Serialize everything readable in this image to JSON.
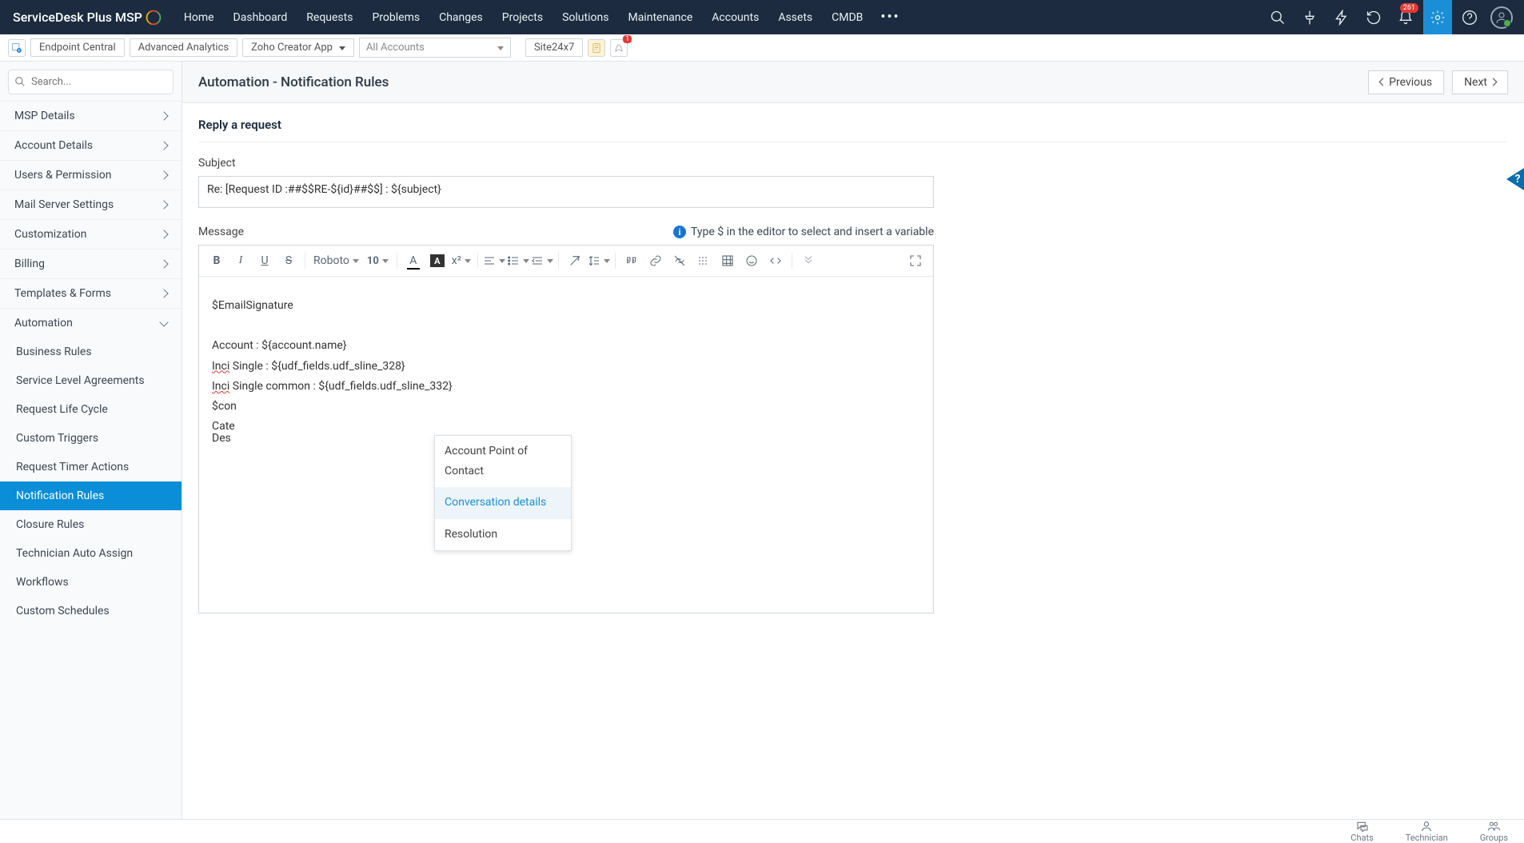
{
  "brand": "ServiceDesk Plus MSP",
  "topnav": [
    "Home",
    "Dashboard",
    "Requests",
    "Problems",
    "Changes",
    "Projects",
    "Solutions",
    "Maintenance",
    "Accounts",
    "Assets",
    "CMDB"
  ],
  "notif_badge": "261",
  "secbar": {
    "endpoint": "Endpoint Central",
    "analytics": "Advanced Analytics",
    "zoho": "Zoho Creator App",
    "accounts": "All Accounts",
    "site": "Site24x7",
    "rocket_badge": "1"
  },
  "sidebar_search_ph": "Search...",
  "sidebar_sections": [
    "MSP Details",
    "Account Details",
    "Users & Permission",
    "Mail Server Settings",
    "Customization",
    "Billing",
    "Templates & Forms"
  ],
  "sidebar_automation": "Automation",
  "automation_items": [
    "Business Rules",
    "Service Level Agreements",
    "Request Life Cycle",
    "Custom Triggers",
    "Request Timer Actions",
    "Notification Rules",
    "Closure Rules",
    "Technician Auto Assign",
    "Workflows",
    "Custom Schedules"
  ],
  "automation_active_idx": 5,
  "content": {
    "title": "Automation - Notification Rules",
    "prev": "Previous",
    "next": "Next",
    "form_title": "Reply a request",
    "subject_label": "Subject",
    "subject_value": "Re: [Request ID :##$$RE-${id}##$$] : ${subject}",
    "message_label": "Message",
    "hint": "Type $ in the editor to select and insert a variable",
    "font_name": "Roboto",
    "font_size": "10",
    "body_lines": {
      "sig": "$EmailSignature",
      "account": "Account : ${account.name}",
      "inci_word": "Inci",
      "inci_single_rest": " Single : ${udf_fields.udf_sline_328}",
      "inci_common_rest": " Single common : ${udf_fields.udf_sline_332}",
      "con": "$con",
      "cate": "Cate",
      "desc": "Des"
    },
    "autocomplete": [
      "Account Point of Contact",
      "Conversation details",
      "Resolution"
    ],
    "autocomplete_hl_idx": 1
  },
  "footer": {
    "chats": "Chats",
    "technician": "Technician",
    "groups": "Groups"
  }
}
